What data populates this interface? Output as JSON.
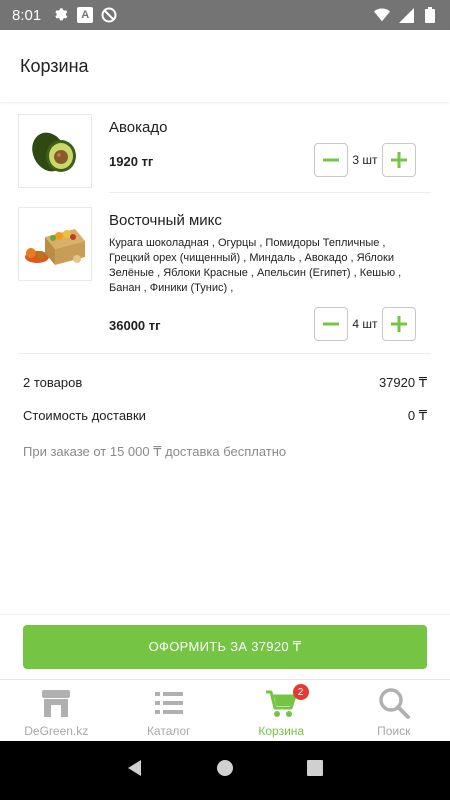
{
  "status_bar": {
    "time": "8:01",
    "a_badge": "A"
  },
  "app_bar": {
    "title": "Корзина"
  },
  "cart": {
    "items": [
      {
        "name": "Авокадо",
        "description": "",
        "price": "1920 тг",
        "qty_label": "3 шт",
        "quantity": 3
      },
      {
        "name": "Восточный микс",
        "description": "Курага шоколадная , Огурцы , Помидоры Тепличные , Грецкий орех (чищенный) , Миндаль , Авокадо , Яблоки Зелёные , Яблоки Красные , Апельсин (Египет) , Кешью , Банан , Финики (Тунис) ,",
        "price": "36000 тг",
        "qty_label": "4 шт",
        "quantity": 4
      }
    ]
  },
  "summary": {
    "items_count_label": "2 товаров",
    "items_total": "37920 ₸",
    "delivery_label": "Стоимость доставки",
    "delivery_cost": "0 ₸",
    "free_delivery_note": "При заказе от 15 000 ₸ доставка бесплатно"
  },
  "checkout": {
    "label": "ОФОРМИТЬ ЗА 37920 ₸"
  },
  "bottom_nav": {
    "items": [
      {
        "label": "DeGreen.kz",
        "icon": "store-icon"
      },
      {
        "label": "Каталог",
        "icon": "list-icon"
      },
      {
        "label": "Корзина",
        "icon": "cart-icon",
        "badge": "2",
        "active": true
      },
      {
        "label": "Поиск",
        "icon": "search-icon"
      }
    ]
  },
  "colors": {
    "accent": "#76c443",
    "status_bar": "#747474",
    "badge": "#e53935",
    "inactive": "#a8a8a8"
  }
}
